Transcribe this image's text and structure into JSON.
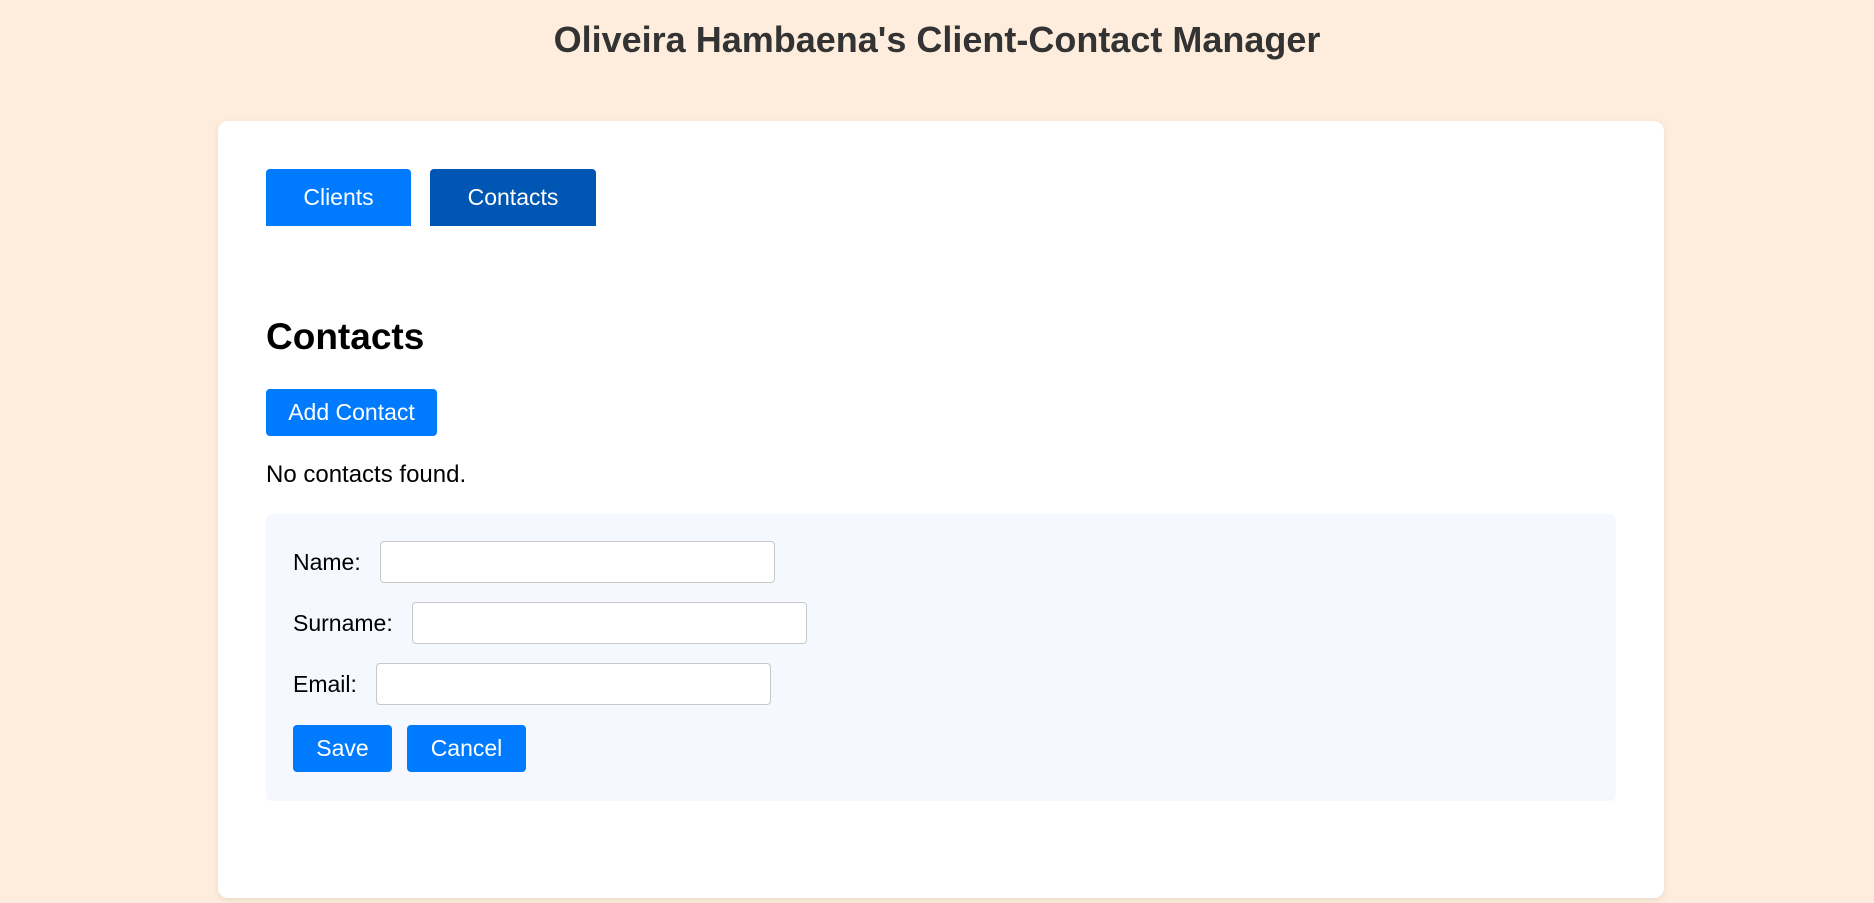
{
  "app": {
    "title": "Oliveira Hambaena's Client-Contact Manager"
  },
  "tabs": [
    {
      "label": "Clients",
      "active": false
    },
    {
      "label": "Contacts",
      "active": true
    }
  ],
  "contacts": {
    "heading": "Contacts",
    "add_label": "Add Contact",
    "empty_message": "No contacts found."
  },
  "form": {
    "fields": [
      {
        "label": "Name:",
        "value": "",
        "placeholder": ""
      },
      {
        "label": "Surname:",
        "value": "",
        "placeholder": ""
      },
      {
        "label": "Email:",
        "value": "",
        "placeholder": ""
      }
    ],
    "save_label": "Save",
    "cancel_label": "Cancel"
  },
  "colors": {
    "background": "#feeddc",
    "primary": "#007bff",
    "primary_active": "#0056b3",
    "form_panel": "#f5f9ff"
  }
}
